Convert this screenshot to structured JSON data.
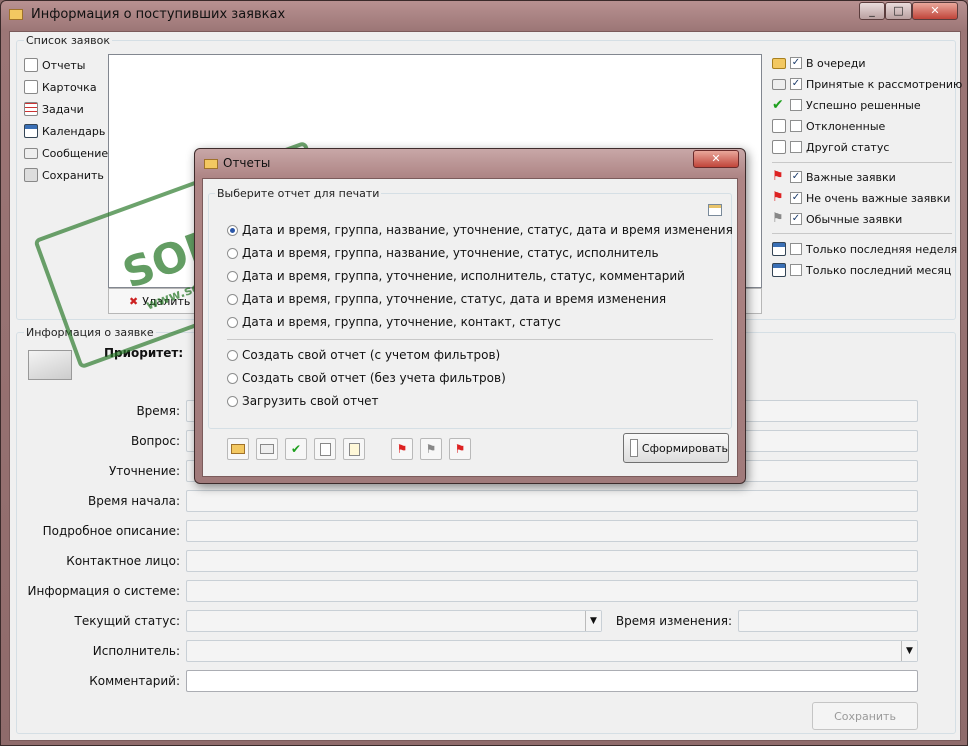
{
  "window": {
    "title": "Информация о поступивших заявках"
  },
  "list_group": {
    "legend": "Список заявок"
  },
  "sidebar": [
    {
      "label": "Отчеты",
      "icon": "report-icon"
    },
    {
      "label": "Карточка",
      "icon": "card-icon"
    },
    {
      "label": "Задачи",
      "icon": "tasks-icon"
    },
    {
      "label": "Календарь",
      "icon": "calendar-icon"
    },
    {
      "label": "Сообщение",
      "icon": "message-icon"
    },
    {
      "label": "Сохранить",
      "icon": "save-icon"
    }
  ],
  "delete_button": "Удалить",
  "status_filters": [
    {
      "label": "В очереди",
      "checked": true
    },
    {
      "label": "Принятые к рассмотрению",
      "checked": true
    },
    {
      "label": "Успешно решенные",
      "checked": false
    },
    {
      "label": "Отклоненные",
      "checked": false
    },
    {
      "label": "Другой статус",
      "checked": false
    }
  ],
  "importance_filters": [
    {
      "label": "Важные заявки",
      "checked": true
    },
    {
      "label": "Не очень важные заявки",
      "checked": true
    },
    {
      "label": "Обычные заявки",
      "checked": true
    }
  ],
  "period_filters": [
    {
      "label": "Только последняя неделя",
      "checked": false
    },
    {
      "label": "Только последний месяц",
      "checked": false
    }
  ],
  "info_group": {
    "legend": "Информация о заявке",
    "priority_label": "Приоритет:"
  },
  "fields": {
    "time": "Время:",
    "question": "Вопрос:",
    "clarification": "Уточнение:",
    "start_time": "Время начала:",
    "description": "Подробное описание:",
    "contact": "Контактное лицо:",
    "system_info": "Информация о системе:",
    "current_status": "Текущий статус:",
    "change_time": "Время изменения:",
    "executor": "Исполнитель:",
    "comment": "Комментарий:"
  },
  "save_button": "Сохранить",
  "dialog": {
    "title": "Отчеты",
    "legend": "Выберите отчет для печати",
    "reports": [
      {
        "label": "Дата и время, группа, название, уточнение, статус, дата и время изменения",
        "selected": true
      },
      {
        "label": "Дата и время, группа, название, уточнение, статус, исполнитель",
        "selected": false
      },
      {
        "label": "Дата и время, группа, уточнение, исполнитель, статус, комментарий",
        "selected": false
      },
      {
        "label": "Дата и время, группа, уточнение, статус, дата и время изменения",
        "selected": false
      },
      {
        "label": "Дата и время, группа, уточнение, контакт, статус",
        "selected": false
      }
    ],
    "custom": [
      {
        "label": "Создать свой отчет (с учетом фильтров)",
        "selected": false
      },
      {
        "label": "Создать свой отчет (без учета фильтров)",
        "selected": false
      },
      {
        "label": "Загрузить свой отчет",
        "selected": false
      }
    ],
    "generate_button": "Сформировать"
  },
  "watermark": {
    "text": "SOFTPORTAL",
    "url": "www.softportal.com"
  }
}
